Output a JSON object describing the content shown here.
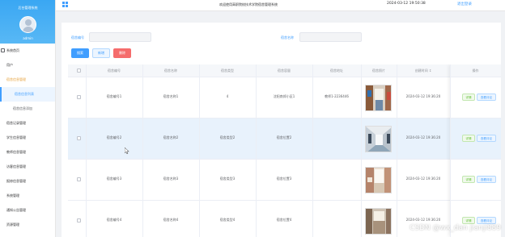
{
  "sidebar": {
    "title": "后台管理系统",
    "user": "admin",
    "items": [
      {
        "label": "系统首页"
      },
      {
        "label": "用户"
      },
      {
        "label": "宿舍信息管理"
      },
      {
        "label": "宿舍信息列表"
      },
      {
        "label": "宿舍信息添加"
      },
      {
        "label": "宿舍记录管理"
      },
      {
        "label": "学生信息管理"
      },
      {
        "label": "教师信息管理"
      },
      {
        "label": "访客信息管理"
      },
      {
        "label": "报修信息管理"
      },
      {
        "label": "系统管理"
      },
      {
        "label": "通知公告管理"
      },
      {
        "label": "资源管理"
      }
    ]
  },
  "topbar": {
    "welcome": "欢迎使用高职院校技术学院宿舍管理系统",
    "datetime": "2024-03-12 19:50:38",
    "logout": "退出登录"
  },
  "search": {
    "field1_label": "宿舍编号",
    "field1_placeholder": "",
    "field2_label": "宿舍名称",
    "field2_placeholder": ""
  },
  "buttons": {
    "search": "搜索",
    "add": "新增",
    "delete": "删除"
  },
  "table": {
    "headers": [
      "宿舍编号",
      "宿舍名称",
      "宿舍类型",
      "宿舍容量",
      "宿舍地址",
      "宿舍照片",
      "创建时间 ↕",
      "操作"
    ],
    "rows": [
      {
        "no": "宿舍编号1",
        "name": "宿舍名称1",
        "type": "4",
        "cap": "沈阳南郊小区1",
        "addr": "教师1-2236446",
        "time": "2024-03-12 19:36:20"
      },
      {
        "no": "宿舍编号2",
        "name": "宿舍名称2",
        "type": "宿舍类型2",
        "cap": "宿舍位置2",
        "addr": "",
        "time": "2024-03-12 19:36:20"
      },
      {
        "no": "宿舍编号3",
        "name": "宿舍名称3",
        "type": "宿舍类型3",
        "cap": "宿舍位置3",
        "addr": "",
        "time": "2024-03-12 19:36:20"
      },
      {
        "no": "宿舍编号4",
        "name": "宿舍名称4",
        "type": "宿舍类型4",
        "cap": "宿舍位置4",
        "addr": "",
        "time": "2024-03-12 19:36:20"
      }
    ],
    "actions": {
      "detail": "详情",
      "edit": "查看评论"
    }
  },
  "watermark": "CSDN @wx_dan jianji889",
  "colors": {
    "accent": "#409eff",
    "danger": "#f56c6c",
    "success": "#67c23a"
  }
}
